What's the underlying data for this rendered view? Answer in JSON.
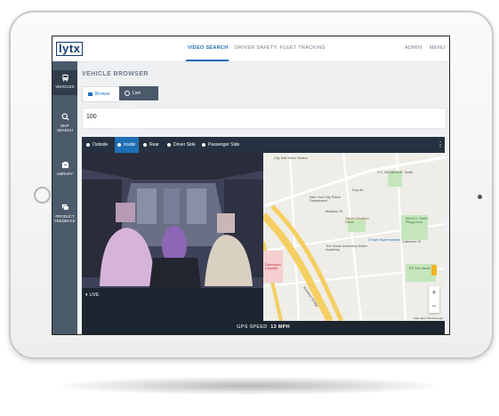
{
  "app": {
    "logo": "lytx"
  },
  "nav": {
    "tabs": [
      "VIDEO SEARCH",
      "DRIVER SAFETY",
      "FLEET TRACKING"
    ],
    "right": [
      "ADMIN",
      "MENU"
    ]
  },
  "sidebar": {
    "items": [
      {
        "label": "VEHICLES",
        "icon": "bus-icon"
      },
      {
        "label": "MAP\nSEARCH",
        "icon": "search-icon"
      },
      {
        "label": "LIBRARY",
        "icon": "folder-icon"
      },
      {
        "label": "PRODUCT\nFEEDBACK",
        "icon": "chat-icon"
      }
    ]
  },
  "main": {
    "title": "VEHICLE BROWSER",
    "modes": {
      "browse": "Browse",
      "live": "Live (beta)"
    },
    "search_value": "100",
    "camera_tabs": [
      "Outside",
      "Inside",
      "Rear",
      "Driver Side",
      "Passenger Side"
    ],
    "active_camera": "Inside",
    "live_label": "LIVE",
    "gps_label": "GPS SPEED",
    "gps_value": "13 MPH"
  },
  "map": {
    "labels": [
      "City Hall Metro Station",
      "New York City Police Department",
      "Madison St",
      "James Madison Plaza",
      "CTown Supermarkets",
      "The Urban Assembly Maker Academy",
      "Alfred E. Smith Playground",
      "Roy Ad",
      "Brooklyn Bridge",
      "P.S. 001 Alfred E. Smith",
      "Downtown Hospital",
      "PS 126 Jacob Riis",
      "Catherine St"
    ],
    "zoom_in": "+",
    "zoom_out": "−",
    "credit": "Map data ©2019 Google"
  },
  "colors": {
    "accent": "#1f6fb5",
    "sidebar": "#4a5a6a",
    "dark_bar": "#1c2530"
  }
}
